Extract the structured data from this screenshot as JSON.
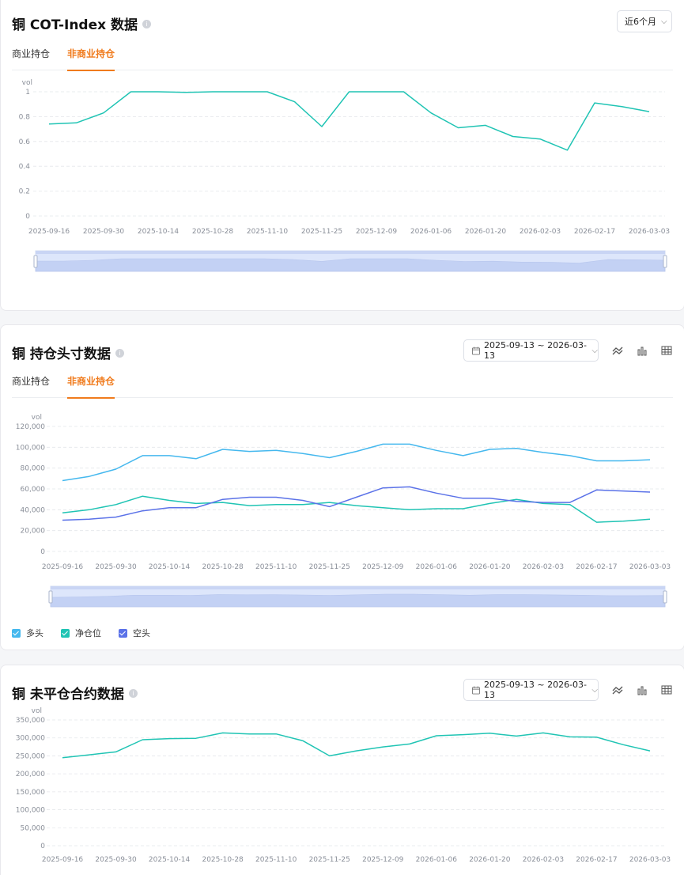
{
  "colors": {
    "accent": "#f07b1d",
    "teal": "#20c4b4",
    "sky": "#45b8ee",
    "indigo": "#5b72e8"
  },
  "cot": {
    "title": "铜 COT-Index 数据",
    "range_label": "近6个月",
    "tabs": [
      {
        "label": "商业持仓"
      },
      {
        "label": "非商业持仓"
      }
    ],
    "active_tab": 1
  },
  "position": {
    "title": "铜 持仓头寸数据",
    "date_range": "2025-09-13 ~ 2026-03-13",
    "tabs": [
      {
        "label": "商业持仓"
      },
      {
        "label": "非商业持仓"
      }
    ],
    "active_tab": 1,
    "tools": [
      "line-chart-icon",
      "bar-chart-icon",
      "table-icon"
    ],
    "legend": [
      {
        "label": "多头",
        "color": "#45b8ee"
      },
      {
        "label": "净仓位",
        "color": "#20c4b4"
      },
      {
        "label": "空头",
        "color": "#5b72e8"
      }
    ]
  },
  "oi": {
    "title": "铜 未平仓合约数据",
    "date_range": "2025-09-13 ~ 2026-03-13",
    "tools": [
      "line-chart-icon",
      "bar-chart-icon",
      "table-icon"
    ]
  },
  "chart_data": [
    {
      "type": "line",
      "ylabel": "vol",
      "yticks": [
        "0",
        "0.2",
        "0.4",
        "0.6",
        "0.8",
        "1"
      ],
      "ylim": [
        0,
        1
      ],
      "x": [
        "2025-09-16",
        "2025-09-23",
        "2025-09-30",
        "2025-10-07",
        "2025-10-14",
        "2025-10-21",
        "2025-10-28",
        "2025-11-04",
        "2025-11-10",
        "2025-11-18",
        "2025-11-25",
        "2025-12-02",
        "2025-12-09",
        "2025-12-16",
        "2026-01-06",
        "2026-01-13",
        "2026-01-20",
        "2026-01-27",
        "2026-02-03",
        "2026-02-10",
        "2026-02-17",
        "2026-02-24",
        "2026-03-03"
      ],
      "xticks": [
        "2025-09-16",
        "2025-09-30",
        "2025-10-14",
        "2025-10-28",
        "2025-11-10",
        "2025-11-25",
        "2025-12-09",
        "2026-01-06",
        "2026-01-20",
        "2026-02-03",
        "2026-02-17",
        "2026-03-03"
      ],
      "series": [
        {
          "color": "#20c4b4",
          "values": [
            0.74,
            0.75,
            0.83,
            1.0,
            1.0,
            0.995,
            1.0,
            1.0,
            1.0,
            0.92,
            0.72,
            1.0,
            1.0,
            1.0,
            0.83,
            0.71,
            0.73,
            0.64,
            0.62,
            0.53,
            0.91,
            0.88,
            0.84
          ]
        }
      ],
      "grid": true,
      "zoom_slider": true
    },
    {
      "type": "line",
      "ylabel": "vol",
      "yticks": [
        "0",
        "20,000",
        "40,000",
        "60,000",
        "80,000",
        "100,000",
        "120,000"
      ],
      "ylim": [
        0,
        120000
      ],
      "x": [
        "2025-09-16",
        "2025-09-23",
        "2025-09-30",
        "2025-10-07",
        "2025-10-14",
        "2025-10-21",
        "2025-10-28",
        "2025-11-04",
        "2025-11-10",
        "2025-11-18",
        "2025-11-25",
        "2025-12-02",
        "2025-12-09",
        "2025-12-16",
        "2026-01-06",
        "2026-01-13",
        "2026-01-20",
        "2026-01-27",
        "2026-02-03",
        "2026-02-10",
        "2026-02-17",
        "2026-02-24",
        "2026-03-03"
      ],
      "xticks": [
        "2025-09-16",
        "2025-09-30",
        "2025-10-14",
        "2025-10-28",
        "2025-11-10",
        "2025-11-25",
        "2025-12-09",
        "2026-01-06",
        "2026-01-20",
        "2026-02-03",
        "2026-02-17",
        "2026-03-03"
      ],
      "series": [
        {
          "name": "多头",
          "color": "#45b8ee",
          "values": [
            68000,
            72000,
            79000,
            92000,
            92000,
            89000,
            98000,
            96000,
            97000,
            94000,
            90000,
            96000,
            103000,
            103000,
            97000,
            92000,
            98000,
            99000,
            95000,
            92000,
            87000,
            87000,
            88000
          ]
        },
        {
          "name": "净仓位",
          "color": "#20c4b4",
          "values": [
            37000,
            40000,
            45000,
            53000,
            49000,
            46000,
            47000,
            44000,
            45000,
            45000,
            47000,
            44000,
            42000,
            40000,
            41000,
            41000,
            46000,
            50000,
            46000,
            45000,
            28000,
            29000,
            31000
          ]
        },
        {
          "name": "空头",
          "color": "#5b72e8",
          "values": [
            30000,
            31000,
            33000,
            39000,
            42000,
            42000,
            50000,
            52000,
            52000,
            49000,
            43000,
            52000,
            61000,
            62000,
            56000,
            51000,
            51000,
            48000,
            47000,
            47000,
            59000,
            58000,
            57000
          ]
        }
      ],
      "grid": true,
      "zoom_slider": true
    },
    {
      "type": "line",
      "ylabel": "vol",
      "yticks": [
        "0",
        "50,000",
        "100,000",
        "150,000",
        "200,000",
        "250,000",
        "300,000",
        "350,000"
      ],
      "ylim": [
        0,
        350000
      ],
      "x": [
        "2025-09-16",
        "2025-09-23",
        "2025-09-30",
        "2025-10-07",
        "2025-10-14",
        "2025-10-21",
        "2025-10-28",
        "2025-11-04",
        "2025-11-10",
        "2025-11-18",
        "2025-11-25",
        "2025-12-02",
        "2025-12-09",
        "2025-12-16",
        "2026-01-06",
        "2026-01-13",
        "2026-01-20",
        "2026-01-27",
        "2026-02-03",
        "2026-02-10",
        "2026-02-17",
        "2026-02-24",
        "2026-03-03"
      ],
      "xticks": [
        "2025-09-16",
        "2025-09-30",
        "2025-10-14",
        "2025-10-28",
        "2025-11-10",
        "2025-11-25",
        "2025-12-09",
        "2026-01-06",
        "2026-01-20",
        "2026-02-03",
        "2026-02-17",
        "2026-03-03"
      ],
      "series": [
        {
          "color": "#20c4b4",
          "values": [
            245000,
            253000,
            261000,
            295000,
            298000,
            299000,
            314000,
            311000,
            311000,
            292000,
            250000,
            264000,
            275000,
            283000,
            306000,
            309000,
            313000,
            305000,
            314000,
            303000,
            302000,
            281000,
            264000
          ]
        }
      ],
      "grid": true,
      "zoom_slider": false
    }
  ]
}
